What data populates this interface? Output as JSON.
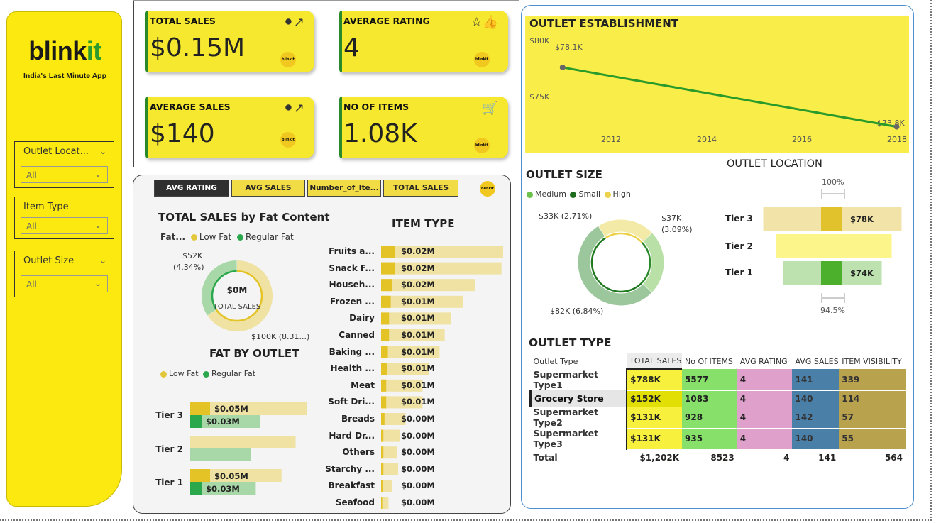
{
  "sidebar": {
    "logo_main": "blink",
    "logo_accent": "it",
    "tagline": "India's Last Minute App",
    "slicers": [
      {
        "title": "Outlet Locat...",
        "value": "All"
      },
      {
        "title": "Item Type",
        "value": "All"
      },
      {
        "title": "Outlet Size",
        "value": "All"
      }
    ]
  },
  "kpis": [
    {
      "title": "TOTAL SALES",
      "value": "$0.15M",
      "icon": "sales-chart-icon"
    },
    {
      "title": "AVERAGE RATING",
      "value": "4",
      "icon": "rating-thumb-icon"
    },
    {
      "title": "AVERAGE SALES",
      "value": "$140",
      "icon": "sales-chart-icon"
    },
    {
      "title": "NO OF ITEMS",
      "value": "1.08K",
      "icon": "basket-icon"
    }
  ],
  "mini_logo": "blinkit",
  "tabs": [
    "AVG RATING",
    "AVG SALES",
    "Number_of_Ite...",
    "TOTAL SALES"
  ],
  "fat_content": {
    "title": "TOTAL SALES by Fat Content",
    "legend_label": "Fat...",
    "series": [
      "Low Fat",
      "Regular Fat"
    ],
    "center_value": "$0M",
    "center_label": "TOTAL SALES",
    "label_top": "$52K",
    "label_top_pct": "(4.34%)",
    "label_bottom": "$100K (8.31...)",
    "chart_data": {
      "type": "pie",
      "categories": [
        "Low Fat",
        "Regular Fat"
      ],
      "values": [
        100,
        52
      ]
    }
  },
  "fat_by_outlet": {
    "title": "FAT BY OUTLET",
    "series": [
      "Low Fat",
      "Regular Fat"
    ],
    "rows": [
      {
        "tier": "Tier 3",
        "low_label": "$0.05M",
        "reg_label": "$0.03M"
      },
      {
        "tier": "Tier 2",
        "low_label": "",
        "reg_label": ""
      },
      {
        "tier": "Tier 1",
        "low_label": "$0.05M",
        "reg_label": "$0.03M"
      }
    ],
    "chart_data": {
      "type": "bar",
      "categories": [
        "Tier 3",
        "Tier 2",
        "Tier 1"
      ],
      "series": [
        {
          "name": "Low Fat",
          "values": [
            0.05,
            0.045,
            0.039
          ],
          "highlight": [
            0.05,
            0,
            0.05
          ]
        },
        {
          "name": "Regular Fat",
          "values": [
            0.03,
            0.026,
            0.028
          ],
          "highlight": [
            0.03,
            0,
            0.03
          ]
        }
      ]
    }
  },
  "item_type": {
    "title": "ITEM TYPE",
    "chart_data": {
      "type": "bar",
      "categories": [
        "Fruits a...",
        "Snack F...",
        "Househ...",
        "Frozen ...",
        "Dairy",
        "Canned",
        "Baking ...",
        "Health ...",
        "Meat",
        "Soft Dri...",
        "Breads",
        "Hard Dr...",
        "Others",
        "Starchy ...",
        "Breakfast",
        "Seafood"
      ],
      "labels": [
        "$0.02M",
        "$0.02M",
        "$0.02M",
        "$0.01M",
        "$0.01M",
        "$0.01M",
        "$0.01M",
        "$0.01M",
        "$0.01M",
        "$0.01M",
        "$0.00M",
        "$0.00M",
        "$0.00M",
        "$0.00M",
        "$0.00M",
        "$0.00M"
      ],
      "values": [
        0.0215,
        0.0212,
        0.0165,
        0.0145,
        0.0123,
        0.0112,
        0.0103,
        0.0085,
        0.0073,
        0.0073,
        0.0043,
        0.0033,
        0.0028,
        0.003,
        0.002,
        0.0013
      ],
      "highlight": [
        0.0024,
        0.0024,
        0.002,
        0.0017,
        0.0014,
        0.0014,
        0.0012,
        0.001,
        0.0009,
        0.0009,
        0.0006,
        0.0004,
        0.0004,
        0.0004,
        0.0003,
        0.0002
      ]
    }
  },
  "outlet_establishment": {
    "title": "OUTLET ESTABLISHMENT",
    "y_ticks": [
      "$80K",
      "$75K"
    ],
    "x_ticks": [
      "2012",
      "2014",
      "2016",
      "2018"
    ],
    "point_labels": [
      "$78.1K",
      "$73.8K"
    ],
    "chart_data": {
      "type": "line",
      "x": [
        2011,
        2018
      ],
      "values": [
        78.1,
        73.8
      ],
      "ylim": [
        71.5,
        80
      ]
    }
  },
  "outlet_size": {
    "title": "OUTLET SIZE",
    "legend": [
      "Medium",
      "Small",
      "High"
    ],
    "labels": [
      "$33K (2.71%)",
      "$37K",
      "(3.09%)",
      "$82K (6.84%)"
    ],
    "chart_data": {
      "type": "pie",
      "categories": [
        "Medium",
        "Small",
        "High"
      ],
      "values": [
        82,
        37,
        33
      ],
      "highlight": [
        6,
        2,
        0
      ]
    }
  },
  "outlet_location": {
    "title": "OUTLET LOCATION",
    "pct_top": "100%",
    "pct_bottom": "94.5%",
    "chart_data": {
      "type": "bar",
      "categories": [
        "Tier 3",
        "Tier 2",
        "Tier 1"
      ],
      "labels": [
        "$78K",
        "",
        "$74K"
      ],
      "values": [
        78,
        70,
        74
      ],
      "highlight": [
        78,
        0,
        74
      ]
    }
  },
  "outlet_type": {
    "title": "OUTLET TYPE",
    "headers": [
      "Outlet Type",
      "TOTAL SALES",
      "No Of ITEMS",
      "AVG RATING",
      "AVG SALES",
      "ITEM VISIBILITY"
    ],
    "rows": [
      [
        "Supermarket Type1",
        "$788K",
        "5577",
        "4",
        "141",
        "339"
      ],
      [
        "Grocery Store",
        "$152K",
        "1083",
        "4",
        "140",
        "114"
      ],
      [
        "Supermarket Type2",
        "$131K",
        "928",
        "4",
        "142",
        "57"
      ],
      [
        "Supermarket Type3",
        "$131K",
        "935",
        "4",
        "140",
        "55"
      ]
    ],
    "total": [
      "Total",
      "$1,202K",
      "8523",
      "4",
      "141",
      "564"
    ]
  }
}
